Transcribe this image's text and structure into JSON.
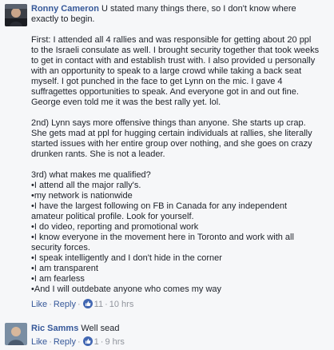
{
  "comment1": {
    "author": "Ronny Cameron",
    "first_line": "U stated many things there, so I don't know where",
    "paragraphs": [
      [
        "exactly to begin."
      ],
      [
        "First: I attended all 4 rallies and was responsible for getting about 20 ppl",
        "to the Israeli consulate as well. I brought security together that took weeks",
        "to get in contact with and establish trust with. I also provided u personally",
        "with an opportunity to speak to a large crowd while taking a back seat",
        "myself. I got punched in the face to get Lynn on the mic. I gave 4",
        "suffragettes opportunities to speak. And everyone got in and out fine.",
        "George even told me it was the best rally yet. lol."
      ],
      [
        "2nd) Lynn says more offensive things than anyone. She starts up crap.",
        "She gets mad at ppl for hugging certain individuals at rallies, she literally",
        "started issues with her entire group over nothing, and she goes on crazy",
        "drunken rants. She is not a leader."
      ],
      [
        "3rd) what makes me qualified?",
        "•I attend all the major rally's.",
        "•my network is nationwide",
        "•I have the largest following on FB in Canada for any independent",
        "amateur political profile. Look for yourself.",
        "•I do video, reporting and promotional work",
        "•I know everyone in the movement here in Toronto and work with all",
        "security forces.",
        "•I speak intelligently and I don't hide in the corner",
        "•I am transparent",
        "•I am fearless",
        "•And I will outdebate anyone who comes my way"
      ]
    ],
    "like_label": "Like",
    "reply_label": "Reply",
    "like_count": "11",
    "time": "10 hrs"
  },
  "comment2": {
    "author": "Ric Samms",
    "text": "Well sead",
    "like_label": "Like",
    "reply_label": "Reply",
    "like_count": "1",
    "time": "9 hrs"
  },
  "colors": {
    "link": "#365899",
    "meta": "#90949c",
    "like_badge": "#4267b2"
  }
}
